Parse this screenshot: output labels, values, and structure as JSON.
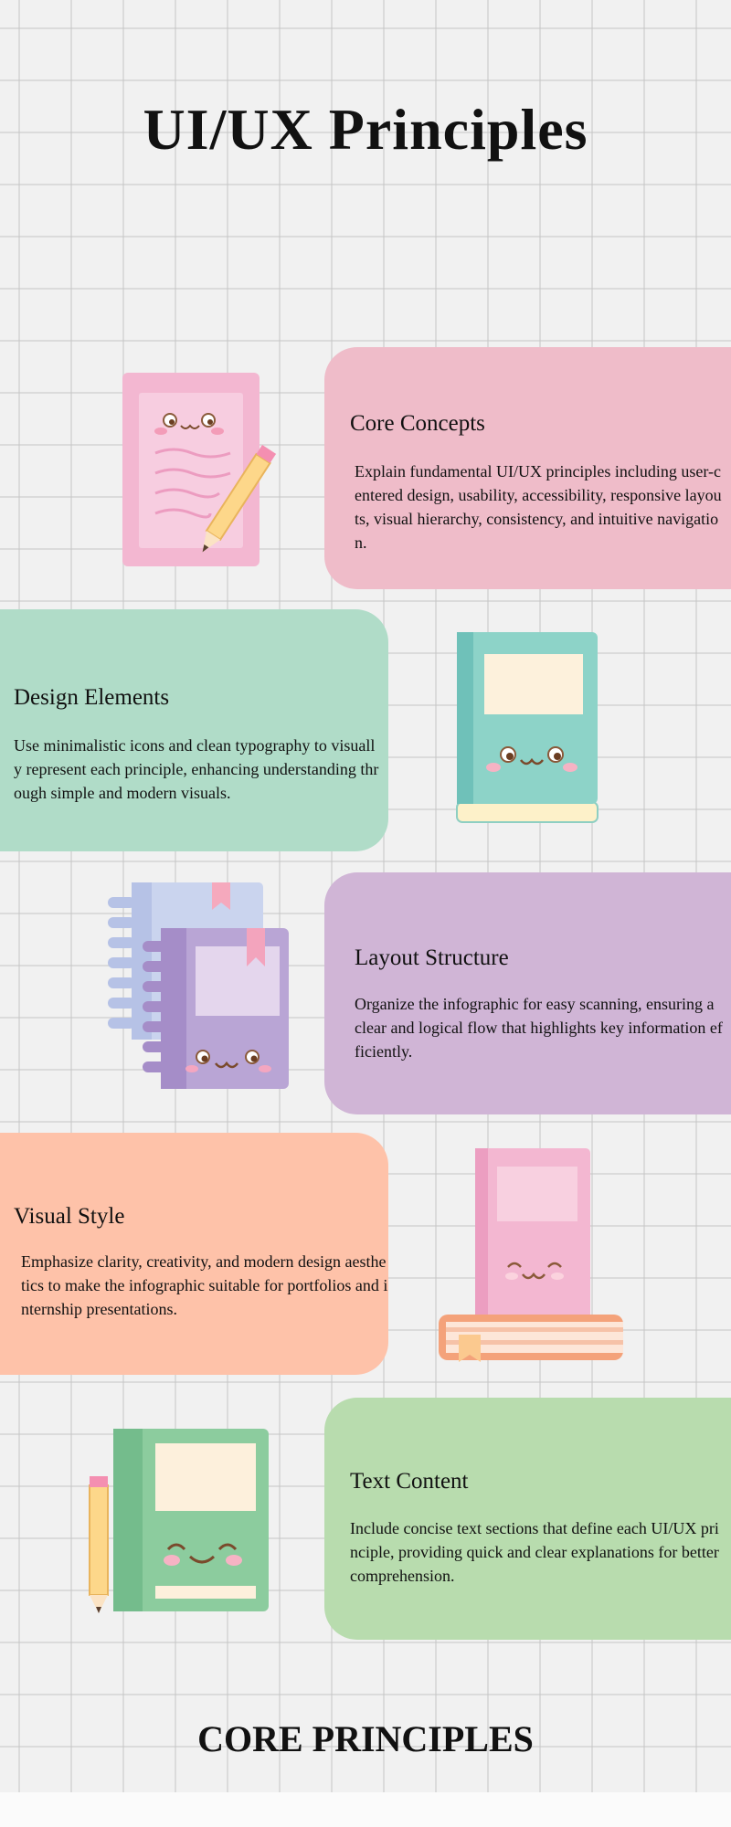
{
  "page": {
    "title": "UI/UX Principles",
    "footer": "CORE PRINCIPLES"
  },
  "sections": [
    {
      "heading": "Core Concepts",
      "text": "Explain fundamental UI/UX principles including user-centered design, usability, accessibility, responsive layouts, visual hierarchy, consistency, and intuitive navigation.",
      "color": "#efbcc9",
      "icon": "notepad-pencil-icon"
    },
    {
      "heading": "Design Elements",
      "text": "Use minimalistic icons and clean typography to visually represent each principle, enhancing understanding through simple and modern visuals.",
      "color": "#b0dcc8",
      "icon": "teal-book-icon"
    },
    {
      "heading": "Layout Structure",
      "text": "Organize the infographic for easy scanning, ensuring a clear and logical flow that highlights key information efficiently.",
      "color": "#d0b5d6",
      "icon": "spiral-notebooks-icon"
    },
    {
      "heading": "Visual Style",
      "text": "Emphasize clarity, creativity, and modern design aesthetics to make the infographic suitable for portfolios and internship presentations.",
      "color": "#fec2a9",
      "icon": "book-stack-icon"
    },
    {
      "heading": "Text Content",
      "text": "Include concise text sections that define each UI/UX principle, providing quick and clear explanations for better comprehension.",
      "color": "#b8dcae",
      "icon": "green-book-pencil-icon"
    }
  ]
}
